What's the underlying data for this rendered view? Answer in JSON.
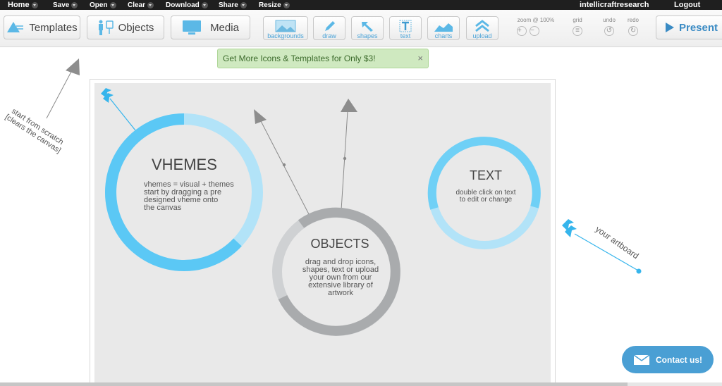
{
  "top_menu": {
    "items": [
      "Home",
      "Save",
      "Open",
      "Clear",
      "Download",
      "Share",
      "Resize"
    ],
    "user": "intellicraftresearch",
    "logout": "Logout"
  },
  "toolbar": {
    "templates": "Templates",
    "objects": "Objects",
    "media": "Media",
    "tools": [
      "backgrounds",
      "draw",
      "shapes",
      "text",
      "charts",
      "upload"
    ],
    "zoom_label": "zoom @ 100%",
    "zoom_in": "+",
    "zoom_out": "−",
    "grid_label": "grid",
    "undo_label": "undo",
    "redo_label": "redo",
    "present": "Present"
  },
  "banner": {
    "text": "Get More Icons & Templates for Only $3!",
    "close": "×"
  },
  "annotations": {
    "left_line1": "start from scratch",
    "left_line2": "[clears the canvas]",
    "right": "your artboard"
  },
  "canvas": {
    "vhemes": {
      "title": "VHEMES",
      "lines": [
        "vhemes = visual + themes",
        "start by dragging a pre",
        "designed vheme onto",
        "the canvas"
      ]
    },
    "objects": {
      "title": "OBJECTS",
      "lines": [
        "drag and drop icons,",
        "shapes, text or upload",
        "your own from our",
        "extensive library of",
        "artwork"
      ]
    },
    "text_block": {
      "title": "TEXT",
      "lines": [
        "double click on text",
        "to edit or change"
      ]
    }
  },
  "contact": {
    "label": "Contact us!"
  },
  "colors": {
    "accent": "#4a9fd4",
    "cyan": "#5bc8f5",
    "light_cyan": "#b2e3f8",
    "gray": "#a9abad",
    "light_gray": "#cfd1d3",
    "banner": "#cfe9c0"
  }
}
